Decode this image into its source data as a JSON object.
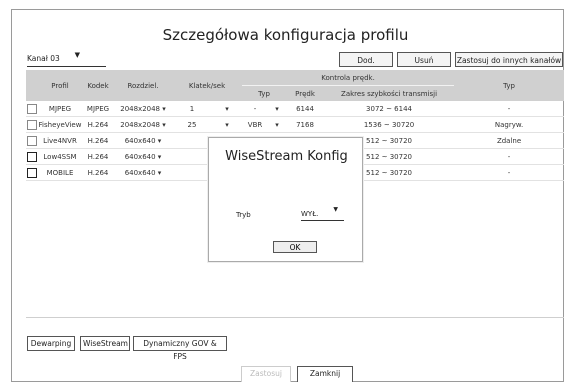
{
  "title": "Szczegółowa konfiguracja profilu",
  "channel": {
    "value": "Kanał 03",
    "arrow": "▼"
  },
  "top_buttons": {
    "add": "Dod.",
    "delete": "Usuń",
    "apply_others": "Zastosuj do innych kanałów"
  },
  "table": {
    "headers": {
      "profile": "Profil",
      "codec": "Kodek",
      "resolution": "Rozdziel.",
      "fps": "Klatek/sek",
      "bitrate_control": "Kontrola prędk.",
      "type": "Typ",
      "speed": "Prędk",
      "range": "Zakres szybkości transmisji",
      "type2": "Typ"
    },
    "rows": [
      {
        "profile": "MJPEG",
        "codec": "MJPEG",
        "resolution": "2048x2048 ▾",
        "fps": "1",
        "fps_arrow": "▾",
        "type": "-",
        "type_arrow": "▾",
        "speed": "6144",
        "range": "3072 ~ 6144",
        "type2": "-"
      },
      {
        "profile": "FisheyeView",
        "codec": "H.264",
        "resolution": "2048x2048 ▾",
        "fps": "25",
        "fps_arrow": "▾",
        "type": "VBR",
        "type_arrow": "▾",
        "speed": "7168",
        "range": "1536 ~ 30720",
        "type2": "Nagryw."
      },
      {
        "profile": "Live4NVR",
        "codec": "H.264",
        "resolution": "640x640 ▾",
        "fps": "",
        "fps_arrow": "",
        "type": "",
        "type_arrow": "",
        "speed": "",
        "range": "512 ~ 30720",
        "type2": "Zdalne"
      },
      {
        "profile": "Low4SSM",
        "codec": "H.264",
        "resolution": "640x640 ▾",
        "fps": "",
        "fps_arrow": "",
        "type": "",
        "type_arrow": "",
        "speed": "",
        "range": "512 ~ 30720",
        "type2": "-"
      },
      {
        "profile": "MOBILE",
        "codec": "H.264",
        "resolution": "640x640 ▾",
        "fps": "",
        "fps_arrow": "",
        "type": "",
        "type_arrow": "",
        "speed": "",
        "range": "512 ~ 30720",
        "type2": "-"
      }
    ]
  },
  "bottom_buttons": {
    "dewarping": "Dewarping",
    "wisestream": "WiseStream",
    "dynamic_gov": "Dynamiczny GOV & FPS"
  },
  "footer": {
    "apply": "Zastosuj",
    "close": "Zamknij"
  },
  "dialog": {
    "title": "WiseStream Konfig",
    "mode_label": "Tryb",
    "mode_value": "WYŁ.",
    "mode_arrow": "▼",
    "ok": "OK"
  }
}
